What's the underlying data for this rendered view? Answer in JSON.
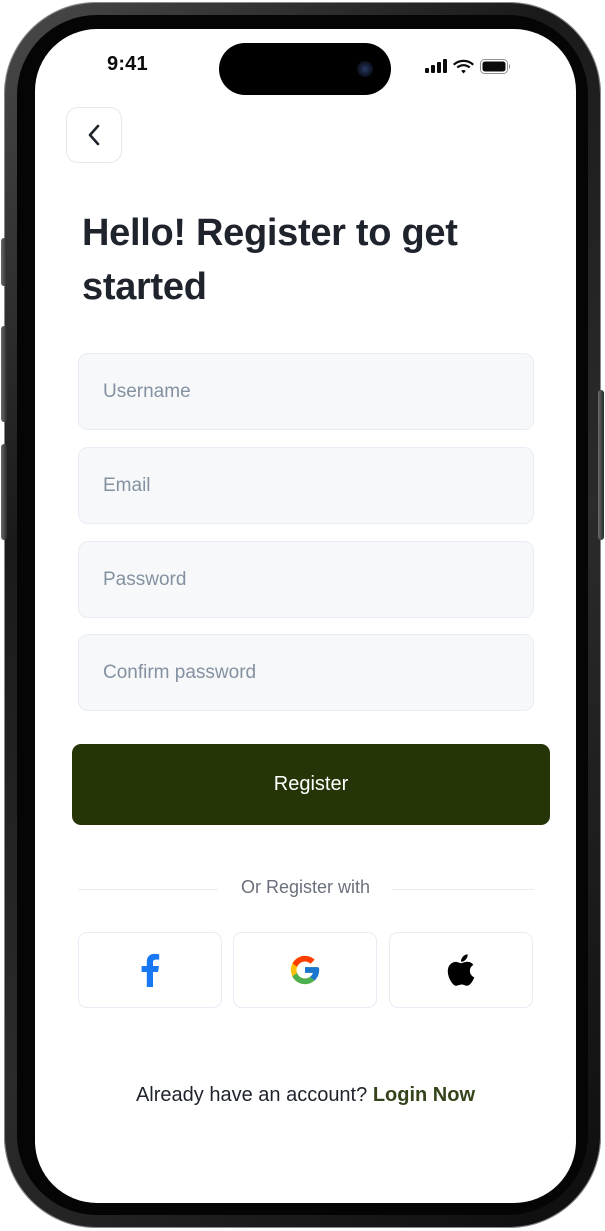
{
  "status_bar": {
    "time": "9:41",
    "icons": [
      "cellular-signal-icon",
      "wifi-icon",
      "battery-icon"
    ]
  },
  "header": {
    "back_icon": "chevron-left-icon"
  },
  "title": "Hello! Register to get started",
  "form": {
    "username": {
      "value": "",
      "placeholder": "Username"
    },
    "email": {
      "value": "",
      "placeholder": "Email"
    },
    "password": {
      "value": "",
      "placeholder": "Password"
    },
    "confirm_password": {
      "value": "",
      "placeholder": "Confirm password"
    }
  },
  "register_button": {
    "label": "Register"
  },
  "divider": {
    "label": "Or Register with"
  },
  "social": [
    {
      "name": "facebook",
      "icon": "facebook-icon"
    },
    {
      "name": "google",
      "icon": "google-icon"
    },
    {
      "name": "apple",
      "icon": "apple-icon"
    }
  ],
  "footer": {
    "prompt": "Already have an account?",
    "link": "Login Now"
  },
  "colors": {
    "primary": "#263507",
    "link": "#35441b",
    "title": "#1e232c",
    "placeholder": "#8391a1",
    "field_bg": "#f7f8f9",
    "field_border": "#e8ecf4",
    "facebook": "#1877f2"
  }
}
